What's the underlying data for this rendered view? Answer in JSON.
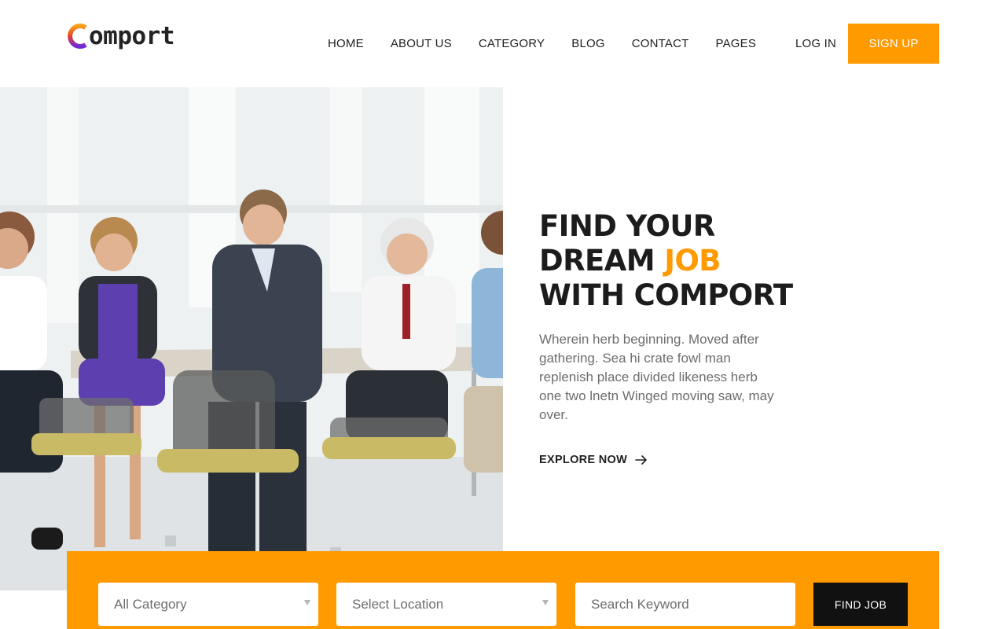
{
  "brand": {
    "name": "omport",
    "logo_letter": "C",
    "colors": {
      "accent": "#ff9a00",
      "dark": "#111111",
      "logo_gradient": [
        "#f9a11b",
        "#e9422b",
        "#6c2bd9"
      ]
    }
  },
  "nav": {
    "items": [
      {
        "label": "HOME"
      },
      {
        "label": "ABOUT US"
      },
      {
        "label": "CATEGORY"
      },
      {
        "label": "BLOG"
      },
      {
        "label": "CONTACT"
      },
      {
        "label": "PAGES"
      }
    ],
    "login_label": "LOG IN",
    "signup_label": "SIGN UP"
  },
  "hero": {
    "headline_line1": "FIND YOUR",
    "headline_line2_prefix": "DREAM ",
    "headline_line2_accent": "JOB",
    "headline_line3": "WITH COMPORT",
    "description": "Wherein herb beginning. Moved after gathering. Sea hi crate fowl man replenish place divided likeness herb one two lnetn Winged moving saw, may over.",
    "explore_label": "EXPLORE NOW",
    "explore_icon": "arrow-right-icon",
    "image_alt": "team-meeting-photo"
  },
  "search": {
    "category_value": "All Category",
    "location_value": "Select Location",
    "keyword_placeholder": "Search Keyword",
    "find_label": "FIND JOB"
  }
}
